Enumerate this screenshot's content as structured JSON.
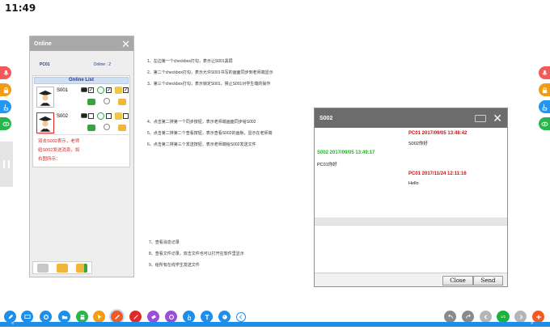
{
  "clock": "11:49",
  "online_panel": {
    "title": "Online",
    "teacher_name": "PC01",
    "online_count": "Online : 2",
    "list_title": "Online List",
    "students": [
      {
        "id": "S001",
        "selected": false
      },
      {
        "id": "S002",
        "selected": true
      }
    ],
    "note_lines": [
      "双击S002表示，老师",
      "给S002发送消息，如",
      "右图所示："
    ]
  },
  "instructions_top": [
    "1、左边第一个checkbox打勾，表示让S001黑屏",
    "2、第二个checkbox打勾，表示允许S001书写的画面同步到老师端显示",
    "3、第三个checkbox打勾，表示锁定S001，禁止S001对学生端的操作"
  ],
  "instructions_mid": [
    "4、点击第二排第一个同步按钮，表示老师端画面同步给S002",
    "5、点击第二排第二个查看按钮，表示查看S002的画板，显示在老师端",
    "6、点击第二排第三个发送按钮，表示老师端给S002发送文件"
  ],
  "instructions_bottom": [
    "7、查看消息记录",
    "8、查看文件记录，双击文件也可以打开在软件里显示",
    "9、给所有在线学生发送文件"
  ],
  "chat": {
    "title": "S002",
    "messages": [
      {
        "header": "PC01 2017/09/05 13:48:42",
        "body": "S002你好",
        "side": "right",
        "color": "#d01010"
      },
      {
        "header": "S002 2017/09/05 13:49:17",
        "body": "PC01你好",
        "side": "left",
        "color": "#18b818"
      },
      {
        "header": "PC01 2017/11/24 12:11:16",
        "body": "Hello",
        "side": "right",
        "color": "#d01010"
      }
    ],
    "close_label": "Close",
    "send_label": "Send"
  },
  "toolbar": {
    "page_indicator": "1/1",
    "accent": "#1e8ee8"
  }
}
